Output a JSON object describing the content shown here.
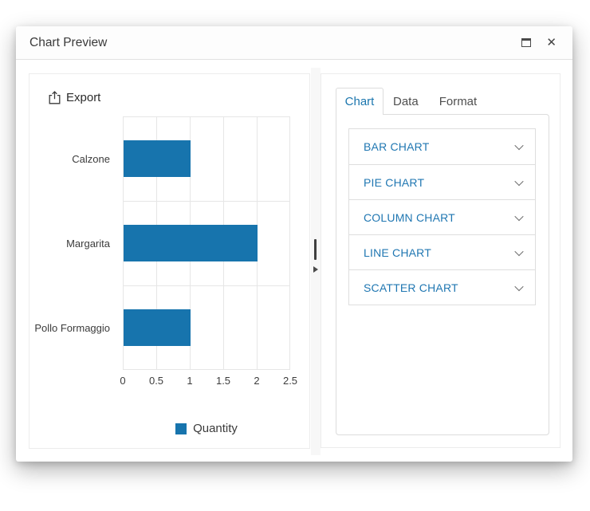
{
  "window": {
    "title": "Chart Preview"
  },
  "left_panel": {
    "export_label": "Export"
  },
  "chart_data": {
    "type": "bar",
    "orientation": "horizontal",
    "categories": [
      "Calzone",
      "Margarita",
      "Pollo Formaggio"
    ],
    "values": [
      1,
      2,
      1
    ],
    "series_name": "Quantity",
    "x_ticks": [
      0,
      0.5,
      1,
      1.5,
      2,
      2.5
    ],
    "xlim": [
      0,
      2.5
    ],
    "bar_color": "#1774ad",
    "grid": true,
    "legend_position": "bottom",
    "title": "",
    "xlabel": "",
    "ylabel": ""
  },
  "right_panel": {
    "tabs": [
      {
        "label": "Chart",
        "active": true
      },
      {
        "label": "Data",
        "active": false
      },
      {
        "label": "Format",
        "active": false
      }
    ],
    "accordion": [
      {
        "label": "BAR CHART"
      },
      {
        "label": "PIE CHART"
      },
      {
        "label": "COLUMN CHART"
      },
      {
        "label": "LINE CHART"
      },
      {
        "label": "SCATTER CHART"
      }
    ]
  },
  "colors": {
    "accent_blue": "#1b76ae",
    "bar_blue": "#1774ad"
  }
}
